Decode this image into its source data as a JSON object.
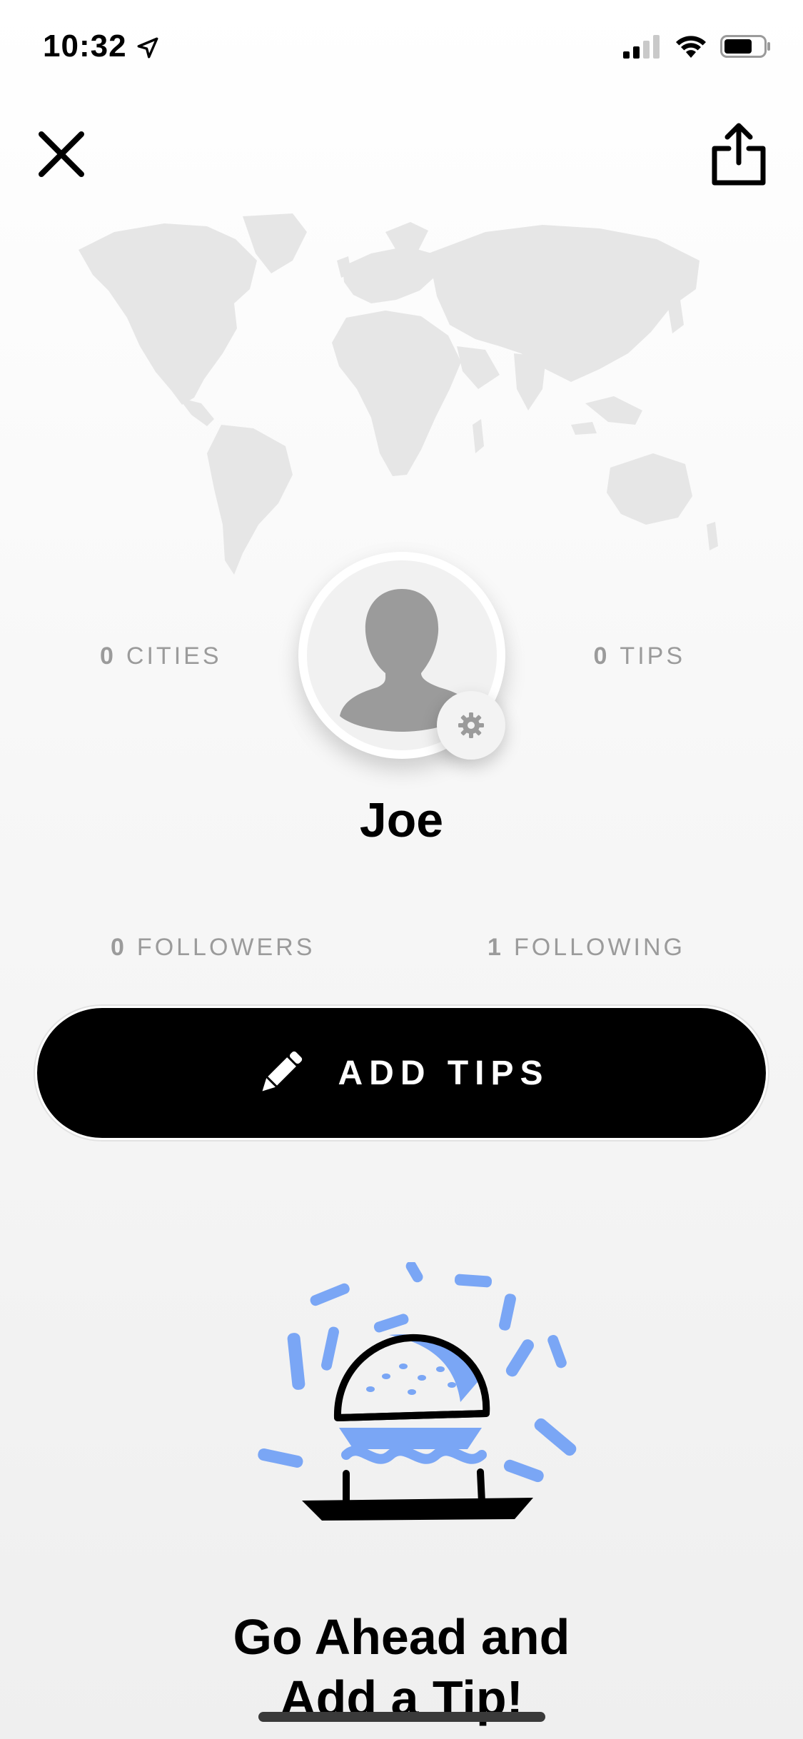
{
  "status_bar": {
    "time": "10:32",
    "icons": [
      "location-arrow-icon",
      "cellular-signal-icon",
      "wifi-icon",
      "battery-icon"
    ]
  },
  "header": {
    "close_icon": "close-icon",
    "share_icon": "share-icon"
  },
  "profile": {
    "name": "Joe",
    "stats": {
      "cities": {
        "count": "0",
        "label": "CITIES"
      },
      "tips": {
        "count": "0",
        "label": "TIPS"
      },
      "followers": {
        "count": "0",
        "label": "FOLLOWERS"
      },
      "following": {
        "count": "1",
        "label": "FOLLOWING"
      }
    },
    "avatar_icon": "default-avatar-icon",
    "settings_icon": "gear-icon"
  },
  "actions": {
    "add_tips_label": "ADD TIPS",
    "add_tips_icon": "pencil-icon"
  },
  "empty_state": {
    "illustration": "burger-illustration",
    "title_line1": "Go Ahead and",
    "title_line2": "Add a Tip!"
  },
  "colors": {
    "accent_blue": "#7aa6f5",
    "primary_black": "#000000",
    "muted_text": "#9b9b9b",
    "map_gray": "#e6e6e6"
  }
}
